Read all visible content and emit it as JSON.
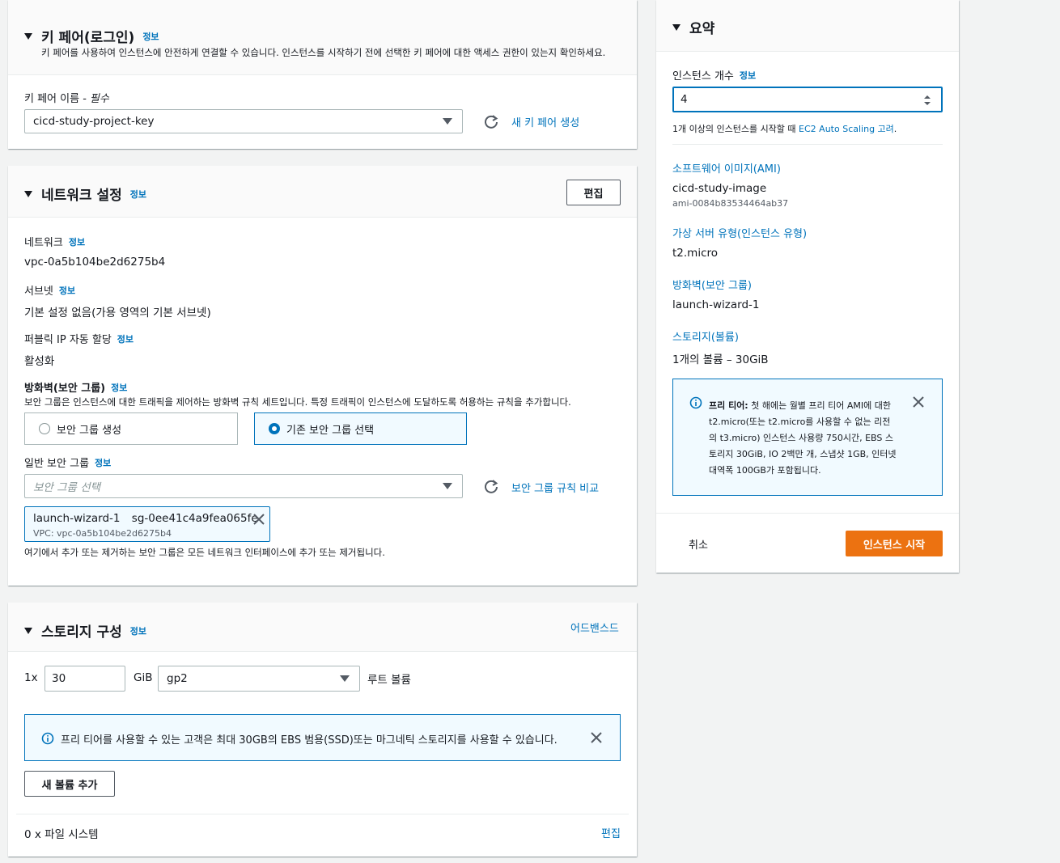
{
  "keypair": {
    "title": "키 페어(로그인)",
    "info": "정보",
    "description": "키 페어를 사용하여 인스턴스에 안전하게 연결할 수 있습니다. 인스턴스를 시작하기 전에 선택한 키 페어에 대한 액세스 권한이 있는지 확인하세요.",
    "name_label": "키 페어 이름 - ",
    "name_required": "필수",
    "selected": "cicd-study-project-key",
    "create_link": "새 키 페어 생성"
  },
  "network": {
    "title": "네트워크 설정",
    "info": "정보",
    "edit_button": "편집",
    "network_label": "네트워크",
    "network_value": "vpc-0a5b104be2d6275b4",
    "subnet_label": "서브넷",
    "subnet_value": "기본 설정 없음(가용 영역의 기본 서브넷)",
    "public_ip_label": "퍼블릭 IP 자동 할당",
    "public_ip_value": "활성화",
    "firewall_label": "방화벽(보안 그룹)",
    "firewall_desc": "보안 그룹은 인스턴스에 대한 트래픽을 제어하는 방화벽 규칙 세트입니다. 특정 트래픽이 인스턴스에 도달하도록 허용하는 규칙을 추가합니다.",
    "radio_create": "보안 그룹 생성",
    "radio_existing": "기존 보안 그룹 선택",
    "sg_label": "일반 보안 그룹",
    "sg_placeholder": "보안 그룹 선택",
    "compare_link": "보안 그룹 규칙 비교",
    "token_name": "launch-wizard-1",
    "token_id": "sg-0ee41c4a9fea065fe",
    "token_vpc": "VPC: vpc-0a5b104be2d6275b4",
    "footer_note": "여기에서 추가 또는 제거하는 보안 그룹은 모든 네트워크 인터페이스에 추가 또는 제거됩니다."
  },
  "storage": {
    "title": "스토리지 구성",
    "info": "정보",
    "advanced_link": "어드밴스드",
    "multiplier": "1x",
    "size_value": "30",
    "unit": "GiB",
    "volume_type": "gp2",
    "root_label": "루트 볼륨",
    "alert_text": "프리 티어를 사용할 수 있는 고객은 최대 30GB의 EBS 범용(SSD)또는 마그네틱 스토리지를 사용할 수 있습니다.",
    "add_volume_button": "새 볼륨 추가",
    "filesystem_label": "0 x 파일 시스템",
    "edit_link": "편집"
  },
  "summary": {
    "title": "요약",
    "count_label": "인스턴스 개수",
    "info": "정보",
    "count_value": "4",
    "scaling_pre": "1개 이상의 인스턴스를 시작할 때 ",
    "scaling_link": "EC2 Auto Scaling 고려",
    "scaling_post": ".",
    "ami_link": "소프트웨어 이미지(AMI)",
    "ami_name": "cicd-study-image",
    "ami_id": "ami-0084b83534464ab37",
    "type_link": "가상 서버 유형(인스턴스 유형)",
    "type_value": "t2.micro",
    "fw_link": "방화벽(보안 그룹)",
    "fw_value": "launch-wizard-1",
    "storage_link": "스토리지(볼륨)",
    "storage_value": "1개의 볼륨 – 30GiB",
    "free_tier_bold": "프리 티어:",
    "free_tier_line1": " 첫 해에는 월별 프리 티어 AMI에 대한",
    "free_tier_line2": "t2.micro(또는 t2.micro를 사용할 수 없는 리전",
    "free_tier_line3": "의 t3.micro) 인스턴스 사용량 750시간, EBS 스",
    "free_tier_line4": "토리지 30GiB, IO 2백만 개, 스냅샷 1GB, 인터넷",
    "free_tier_line5": "대역폭 100GB가 포함됩니다.",
    "cancel": "취소",
    "launch": "인스턴스 시작"
  },
  "colors": {
    "accent": "#0073bb",
    "primary_button": "#ec7211"
  },
  "icons": [
    "caret-down-icon",
    "refresh-icon",
    "close-icon",
    "info-circle-icon"
  ]
}
